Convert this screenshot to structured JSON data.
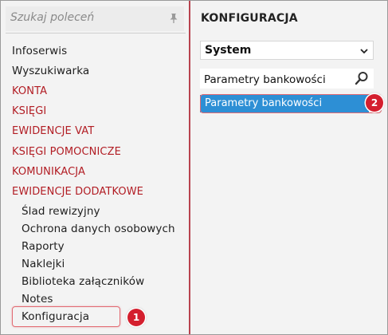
{
  "left_panel": {
    "search": {
      "placeholder": "Szukaj poleceń",
      "pin_icon": "pin-icon"
    },
    "items": [
      {
        "label": "Infoserwis",
        "kind": "item"
      },
      {
        "label": "Wyszukiwarka",
        "kind": "item"
      },
      {
        "label": "KONTA",
        "kind": "section"
      },
      {
        "label": "KSIĘGI",
        "kind": "section"
      },
      {
        "label": "EWIDENCJE VAT",
        "kind": "section"
      },
      {
        "label": "KSIĘGI POMOCNICZE",
        "kind": "section"
      },
      {
        "label": "KOMUNIKACJA",
        "kind": "section"
      },
      {
        "label": "EWIDENCJE DODATKOWE",
        "kind": "section"
      },
      {
        "label": "Ślad rewizyjny",
        "kind": "sub"
      },
      {
        "label": "Ochrona danych osobowych",
        "kind": "sub"
      },
      {
        "label": "Raporty",
        "kind": "sub"
      },
      {
        "label": "Naklejki",
        "kind": "sub"
      },
      {
        "label": "Biblioteka załączników",
        "kind": "sub"
      },
      {
        "label": "Notes",
        "kind": "sub"
      },
      {
        "label": "Konfiguracja",
        "kind": "sub",
        "highlighted": true
      }
    ],
    "callout_number": "1"
  },
  "right_panel": {
    "title": "KONFIGURACJA",
    "select": {
      "value": "System",
      "icon": "chevron-down-icon"
    },
    "search": {
      "value": "Parametry bankowości",
      "icon": "magnifier-icon"
    },
    "results": [
      {
        "label": "Parametry bankowości",
        "selected": true
      }
    ],
    "callout_number": "2"
  },
  "colors": {
    "section_red": "#b21d24",
    "divider": "#b8434f",
    "selection_blue": "#2d8fd5",
    "badge_red": "#d41f2e",
    "background": "#f3f3f3"
  }
}
